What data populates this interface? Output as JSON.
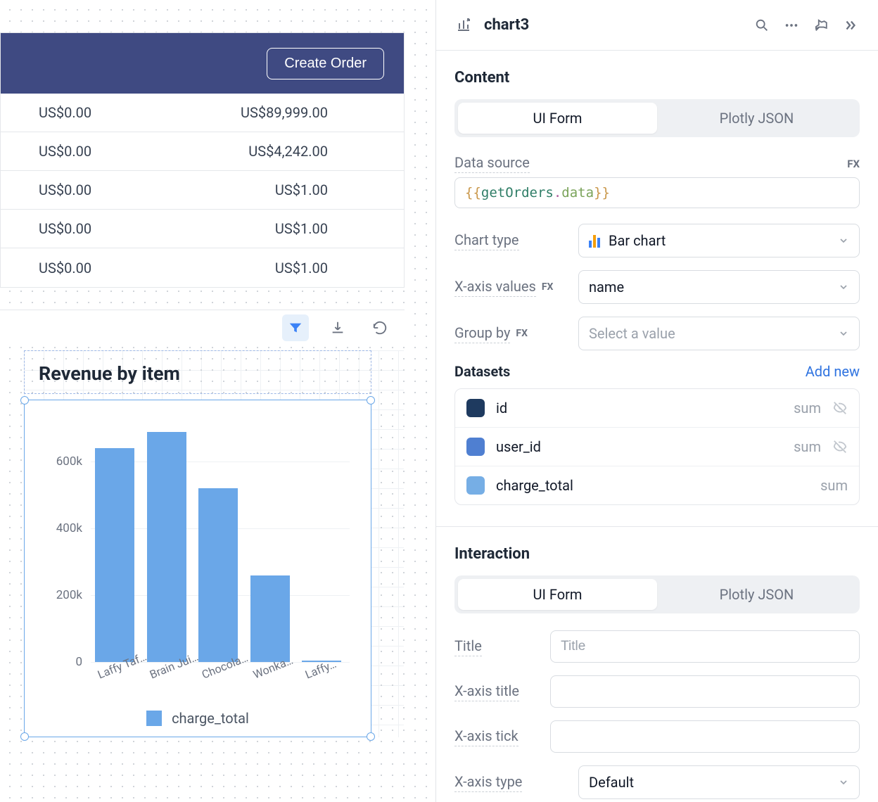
{
  "header": {
    "create_order_label": "Create Order"
  },
  "table": {
    "rows": [
      {
        "a": "US$0.00",
        "b": "US$89,999.00"
      },
      {
        "a": "US$0.00",
        "b": "US$4,242.00"
      },
      {
        "a": "US$0.00",
        "b": "US$1.00"
      },
      {
        "a": "US$0.00",
        "b": "US$1.00"
      },
      {
        "a": "US$0.00",
        "b": "US$1.00"
      }
    ]
  },
  "chart_card": {
    "title": "Revenue by item",
    "legend_label": "charge_total"
  },
  "chart_data": {
    "type": "bar",
    "categories": [
      "Laffy Taf…",
      "Brain Jui…",
      "Chocola…",
      "Wonka…",
      "Laffy…"
    ],
    "values": [
      640000,
      690000,
      520000,
      260000,
      5000
    ],
    "series_name": "charge_total",
    "ylabel": "",
    "xlabel": "",
    "y_ticks": [
      0,
      200000,
      400000,
      600000
    ],
    "y_tick_labels": [
      "0",
      "200k",
      "400k",
      "600k"
    ],
    "ylim": [
      0,
      700000
    ]
  },
  "inspector": {
    "title": "chart3",
    "content": {
      "heading": "Content",
      "tabs": {
        "ui": "UI Form",
        "json": "Plotly JSON"
      },
      "data_source_label": "Data source",
      "fx_label": "FX",
      "data_source_code": {
        "fn": "getOrders",
        "prop": "data"
      },
      "chart_type_label": "Chart type",
      "chart_type_value": "Bar chart",
      "x_values_label": "X-axis values",
      "x_values_value": "name",
      "group_by_label": "Group by",
      "group_by_placeholder": "Select a value",
      "datasets_label": "Datasets",
      "add_new_label": "Add new",
      "datasets": [
        {
          "name": "id",
          "agg": "sum",
          "color": "#1e3a5f",
          "hidden": true
        },
        {
          "name": "user_id",
          "agg": "sum",
          "color": "#4f7fd1",
          "hidden": true
        },
        {
          "name": "charge_total",
          "agg": "sum",
          "color": "#76aee5",
          "hidden": false
        }
      ]
    },
    "interaction": {
      "heading": "Interaction",
      "tabs": {
        "ui": "UI Form",
        "json": "Plotly JSON"
      },
      "title_label": "Title",
      "title_placeholder": "Title",
      "x_title_label": "X-axis title",
      "x_tick_label": "X-axis tick",
      "x_type_label": "X-axis type",
      "x_type_value": "Default"
    }
  }
}
